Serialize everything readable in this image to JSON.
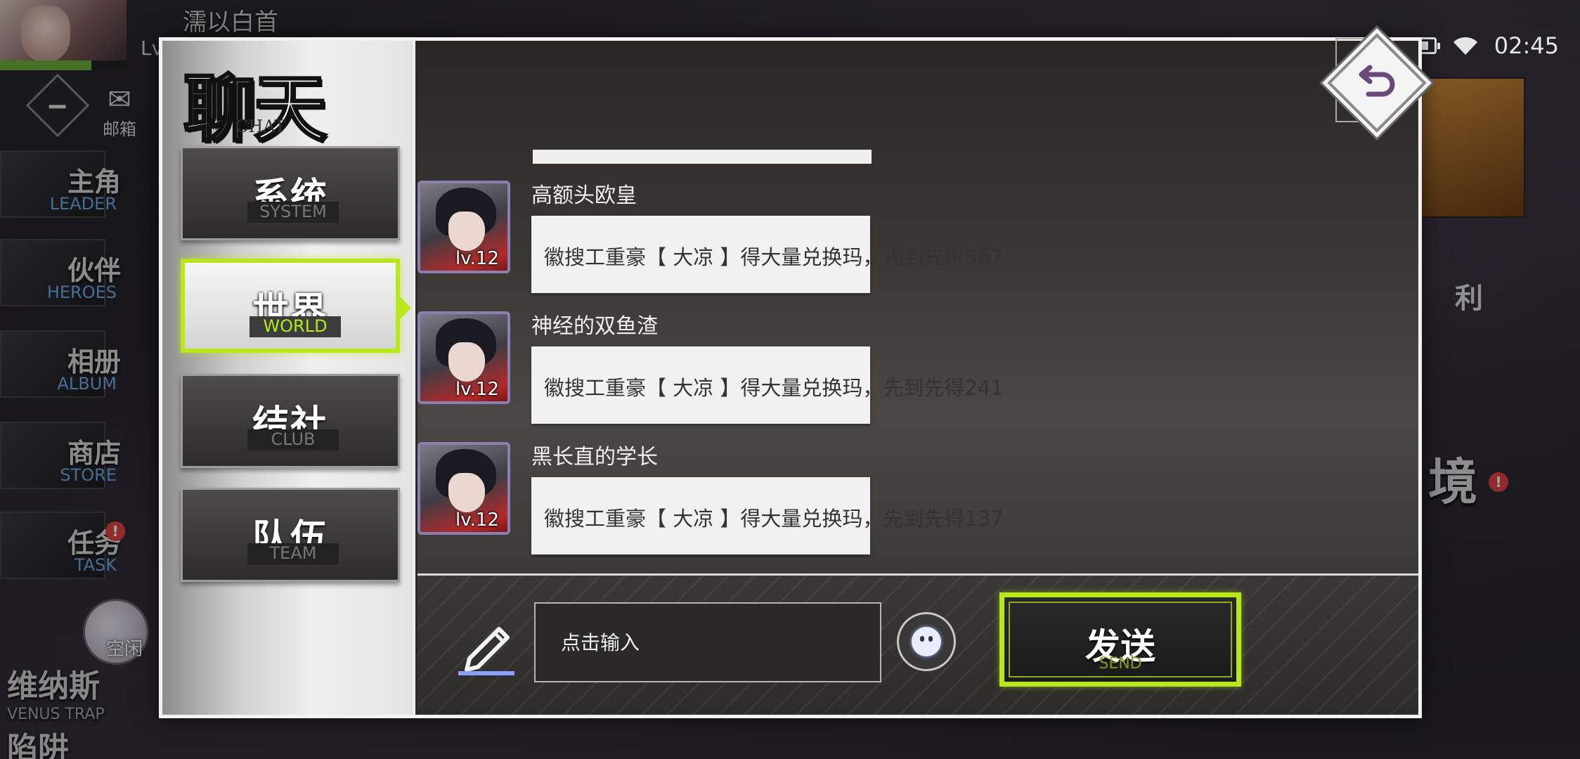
{
  "status_bar": {
    "time": "02:45",
    "battery_level": 0.85,
    "icons": [
      "battery-icon",
      "wifi-icon"
    ]
  },
  "background": {
    "player_title": "濡以白首",
    "level_prefix": "Lv",
    "exp_fill": 0.7,
    "mail": {
      "label": "邮箱",
      "icon": "envelope-icon"
    },
    "side_menu": [
      {
        "cn": "主角",
        "en": "LEADER"
      },
      {
        "cn": "伙伴",
        "en": "HEROES"
      },
      {
        "cn": "相册",
        "en": "ALBUM"
      },
      {
        "cn": "商店",
        "en": "STORE"
      },
      {
        "cn": "任务",
        "en": "TASK"
      }
    ],
    "idle_label": "空闲",
    "venus": {
      "cn1": "维纳斯",
      "en": "VENUS TRAP",
      "cn2": "陷阱"
    },
    "right_glyph_1": "利",
    "right_glyph_2": "境"
  },
  "panel": {
    "title_cn": "聊天",
    "title_en": "CHAT",
    "tabs": [
      {
        "cn": "系统",
        "en": "SYSTEM",
        "active": false
      },
      {
        "cn": "世界",
        "en": "WORLD",
        "active": true
      },
      {
        "cn": "结社",
        "en": "CLUB",
        "active": false
      },
      {
        "cn": "队伍",
        "en": "TEAM",
        "active": false
      }
    ],
    "messages": [
      {
        "name": "高额头欧皇",
        "level": "lv.12",
        "text": "徽搜工重豪【 大凉 】得大量兑换玛，先到先得567"
      },
      {
        "name": "神经的双鱼渣",
        "level": "lv.12",
        "text": "徽搜工重豪【 大凉 】得大量兑换玛，先到先得241"
      },
      {
        "name": "黑长直的学长",
        "level": "lv.12",
        "text": "徽搜工重豪【 大凉 】得大量兑换玛，先到先得137"
      }
    ],
    "input": {
      "placeholder": "点击输入",
      "value": ""
    },
    "send": {
      "cn": "发送",
      "en": "SEND"
    },
    "accent_color": "#b8e81a"
  }
}
